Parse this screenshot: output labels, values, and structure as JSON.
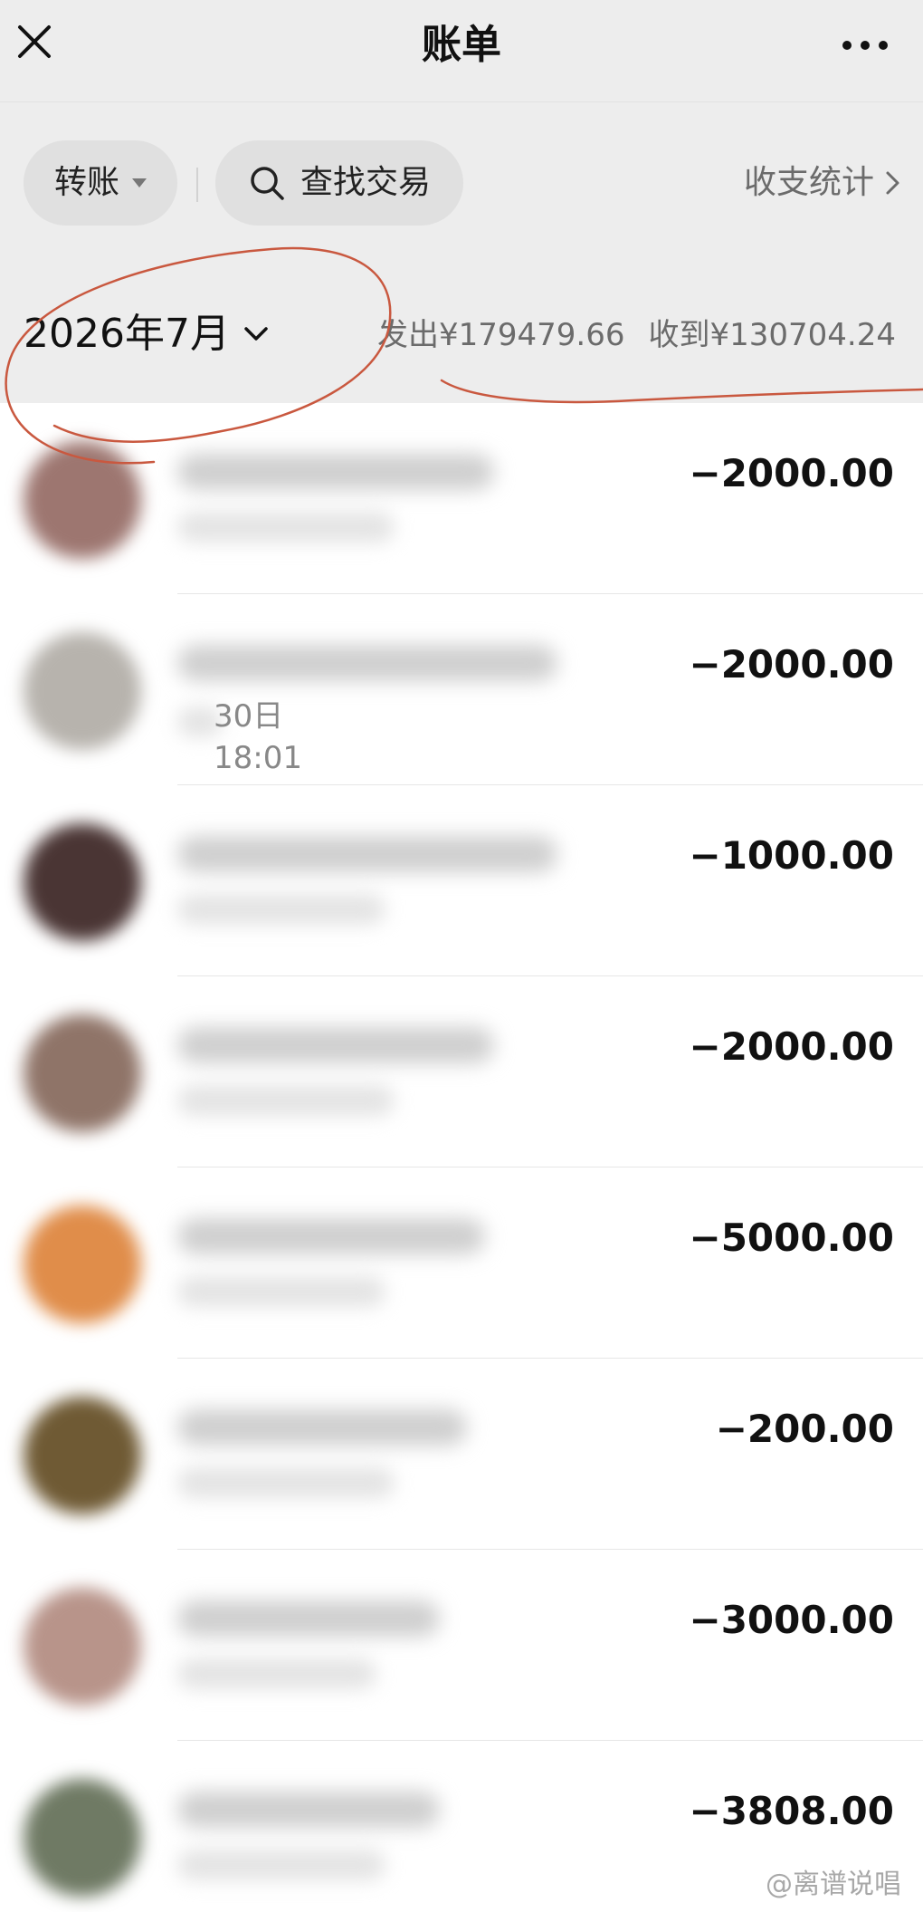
{
  "header": {
    "title": "账单"
  },
  "filters": {
    "type_label": "转账",
    "search_label": "查找交易",
    "stats_label": "收支统计"
  },
  "summary": {
    "month": "2026年7月",
    "sent": "发出¥179479.66",
    "received": "收到¥130704.24"
  },
  "transactions": [
    {
      "amount": "−2000.00",
      "avatar_color": "#9d7670"
    },
    {
      "amount": "−2000.00",
      "avatar_color": "#b7b3ad",
      "time_partial": "30日 18:01"
    },
    {
      "amount": "−1000.00",
      "avatar_color": "#4a3534"
    },
    {
      "amount": "−2000.00",
      "avatar_color": "#8f7468"
    },
    {
      "amount": "−5000.00",
      "avatar_color": "#e08d4a"
    },
    {
      "amount": "−200.00",
      "avatar_color": "#6f5a34"
    },
    {
      "amount": "−3000.00",
      "avatar_color": "#b8948a"
    },
    {
      "amount": "−3808.00",
      "avatar_color": "#6f7a64"
    }
  ],
  "watermark": "@离谱说唱",
  "colors": {
    "header_bg": "#ededed",
    "pill_bg": "#e0e0e0",
    "annotation": "#c9583f"
  }
}
